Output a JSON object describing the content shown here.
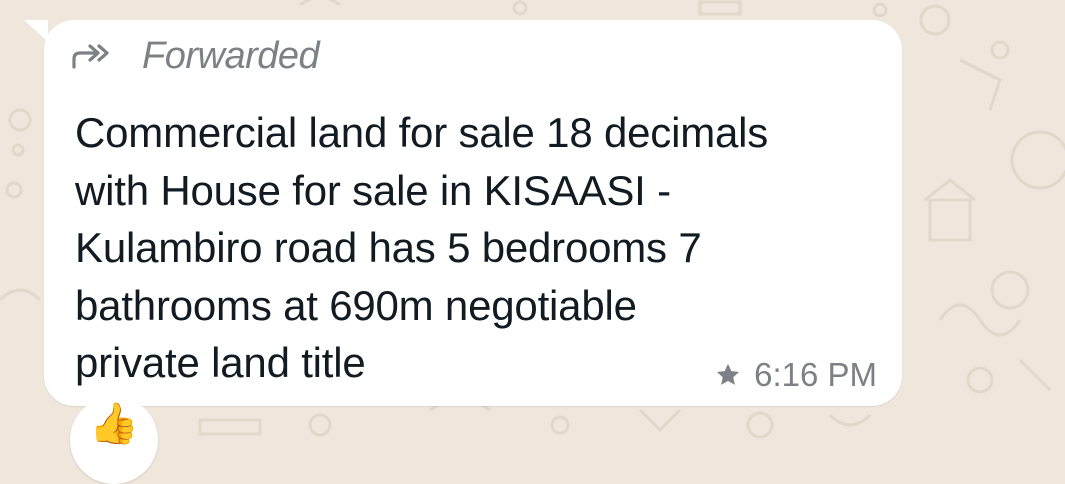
{
  "message": {
    "forwarded_label": "Forwarded",
    "text": "Commercial land for sale 18 decimals\nwith House for sale in KISAASI -\nKulambiro road has 5 bedrooms 7\nbathrooms at 690m negotiable\nprivate land title",
    "time": "6:16 PM",
    "starred": true,
    "reaction": "👍"
  },
  "icons": {
    "forward": "forward-arrow-icon",
    "star": "star-icon"
  },
  "colors": {
    "wallpaper": "#efe7dc",
    "bubble": "#ffffff",
    "text": "#111b21",
    "meta": "#7d8186"
  }
}
